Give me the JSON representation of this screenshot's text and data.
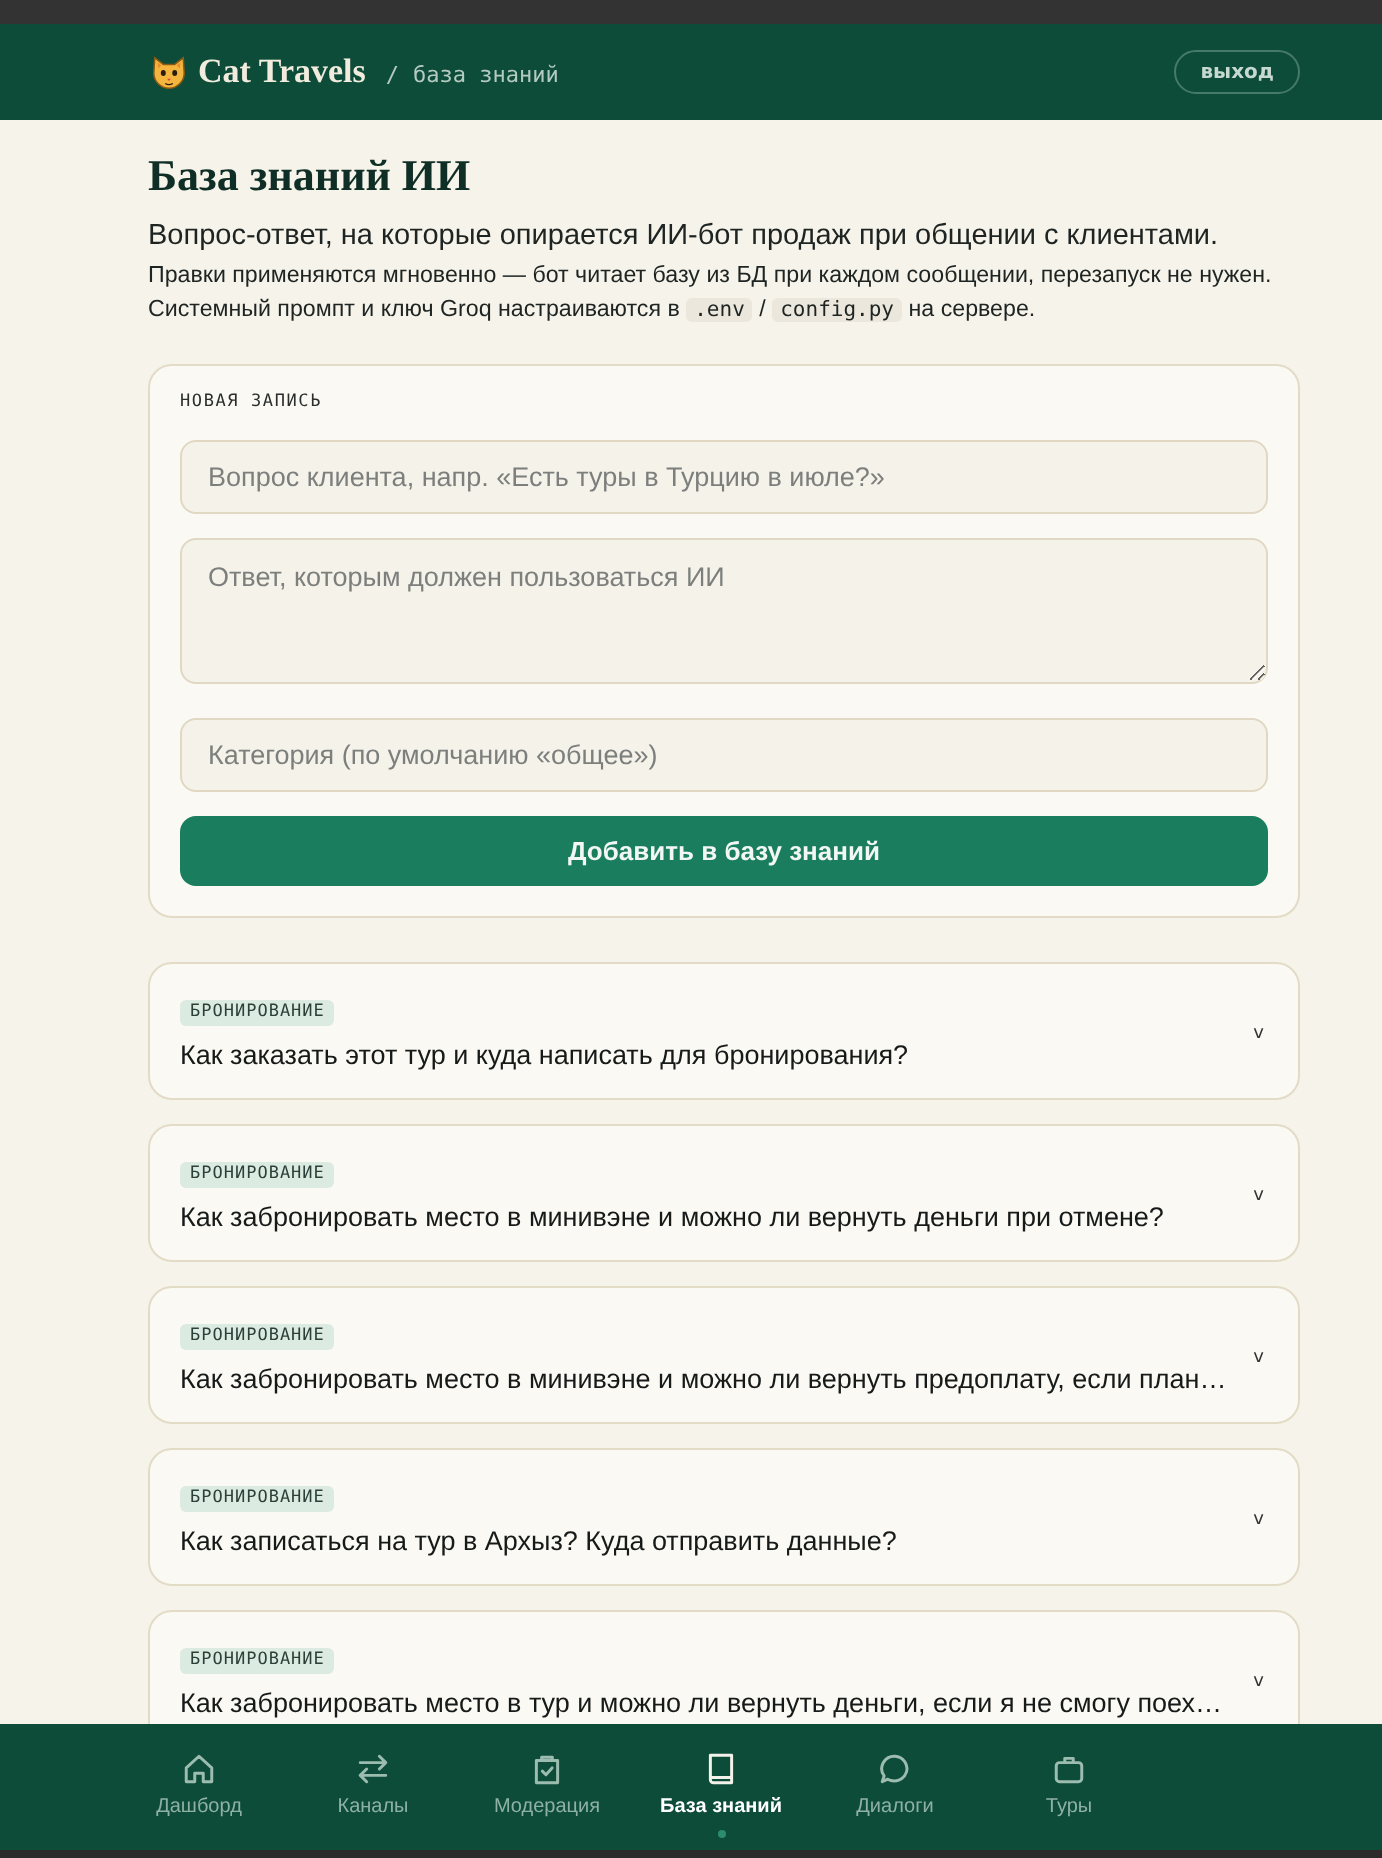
{
  "header": {
    "logo_text": "Cat Travels",
    "breadcrumb_separator": "/",
    "breadcrumb": "база знаний",
    "logout_button": "выход"
  },
  "page": {
    "title": "База знаний ИИ",
    "subtitle": "Вопрос-ответ, на которые опирается ИИ-бот продаж при общении с клиентами.",
    "note_lines": [
      [
        {
          "kind": "text",
          "text": "Правки применяются мгновенно — бот читает базу из БД при каждом сообщении, перезапуск не нужен."
        }
      ],
      [
        {
          "kind": "text",
          "text": "Системный промпт и ключ Groq настраиваются в"
        },
        {
          "kind": "code",
          "text": ".env"
        },
        {
          "kind": "text",
          "text": "/"
        },
        {
          "kind": "code",
          "text": "config.py"
        },
        {
          "kind": "text",
          "text": "на сервере."
        }
      ]
    ]
  },
  "form": {
    "label": "НОВАЯ ЗАПИСЬ",
    "fields": [
      {
        "kind": "input",
        "placeholder": "Вопрос клиента, напр. «Есть туры в Турцию в июле?»"
      },
      {
        "kind": "textarea",
        "placeholder": "Ответ, которым должен пользоваться ИИ"
      },
      {
        "kind": "input",
        "placeholder": "Категория (по умолчанию «общее»)"
      }
    ],
    "submit_button": "Добавить в базу знаний"
  },
  "entries": [
    {
      "category": "БРОНИРОВАНИЕ",
      "question": "Как заказать этот тур и куда написать для бронирования?",
      "toggle": "v"
    },
    {
      "category": "БРОНИРОВАНИЕ",
      "question": "Как забронировать место в минивэне и можно ли вернуть деньги при отмене?",
      "toggle": "v"
    },
    {
      "category": "БРОНИРОВАНИЕ",
      "question": "Как забронировать место в минивэне и можно ли вернуть предоплату, если план…",
      "toggle": "v"
    },
    {
      "category": "БРОНИРОВАНИЕ",
      "question": "Как записаться на тур в Архыз? Куда отправить данные?",
      "toggle": "v"
    },
    {
      "category": "БРОНИРОВАНИЕ",
      "question": "Как забронировать место в тур и можно ли вернуть деньги, если я не смогу поех…",
      "toggle": "v"
    }
  ],
  "nav": [
    {
      "kind": "home",
      "label": "Дашборд",
      "selected": false
    },
    {
      "kind": "arrows",
      "label": "Каналы",
      "selected": false
    },
    {
      "kind": "bag",
      "label": "Модерация",
      "selected": false
    },
    {
      "kind": "book",
      "label": "База знаний",
      "selected": true
    },
    {
      "kind": "chat",
      "label": "Диалоги",
      "selected": false
    },
    {
      "kind": "suitcase",
      "label": "Туры",
      "selected": false
    }
  ]
}
